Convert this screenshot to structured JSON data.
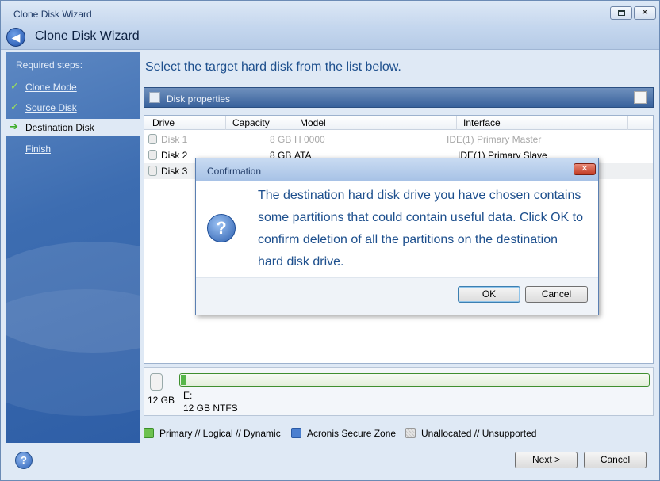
{
  "window": {
    "title": "Clone Disk Wizard",
    "restore_glyph": "restore-icon",
    "close_glyph": "✕"
  },
  "header": {
    "back_glyph": "◀",
    "title": "Clone Disk Wizard"
  },
  "sidebar": {
    "heading": "Required steps:",
    "steps": [
      {
        "label": "Clone Mode",
        "state": "done",
        "glyph": "✓"
      },
      {
        "label": "Source Disk",
        "state": "done",
        "glyph": "✓"
      },
      {
        "label": "Destination Disk",
        "state": "current",
        "glyph": "➔"
      },
      {
        "label": "Finish",
        "state": "pending"
      }
    ]
  },
  "main": {
    "prompt": "Select the target hard disk from the list below.",
    "toolbar_label": "Disk properties",
    "columns": [
      "Drive",
      "Capacity",
      "Model",
      "Interface"
    ],
    "rows": [
      {
        "drive": "Disk 1",
        "capacity": "8 GB",
        "model": "H 0000",
        "interface": "IDE(1) Primary Master",
        "disabled": true
      },
      {
        "drive": "Disk 2",
        "capacity": "8 GB",
        "model": "ATA",
        "interface": "IDE(1) Primary Slave",
        "disabled": false
      },
      {
        "drive": "Disk 3",
        "capacity": "",
        "model": "",
        "interface": "",
        "disabled": false
      }
    ],
    "partition": {
      "disk_size": "12 GB",
      "volume": "E:",
      "fs": "12 GB  NTFS",
      "used_fraction": 0.01
    },
    "legend": [
      {
        "label": "Primary // Logical // Dynamic",
        "color": "#6cc14f"
      },
      {
        "label": "Acronis Secure Zone",
        "color": "#4a7fd0"
      },
      {
        "label": "Unallocated // Unsupported",
        "color": "#d8d8d8"
      }
    ]
  },
  "footer": {
    "help_glyph": "?",
    "next_label": "Next >",
    "cancel_label": "Cancel"
  },
  "dialog": {
    "title": "Confirmation",
    "close_glyph": "✕",
    "icon_glyph": "?",
    "message": "The destination hard disk drive you have chosen contains some partitions that could contain useful data. Click OK to confirm deletion of all the partitions on the destination hard disk drive.",
    "ok_label": "OK",
    "cancel_label": "Cancel"
  }
}
